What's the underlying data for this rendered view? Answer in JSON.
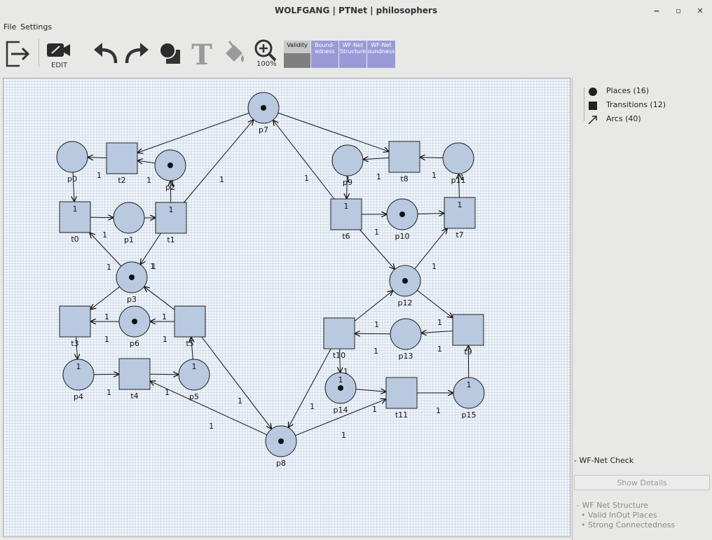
{
  "window": {
    "title": "WOLFGANG | PTNet | philosophers",
    "minimize": "‒",
    "maximize": "▫",
    "close": "✕"
  },
  "menu": {
    "file": "File",
    "settings": "Settings"
  },
  "toolbar": {
    "edit_label": "EDIT",
    "zoom_label": "100%",
    "checks": [
      {
        "label": "Validity",
        "color": "#7f7f7f"
      },
      {
        "label": "Bound-\nedness",
        "color": "#9b9ad8"
      },
      {
        "label": "WF-Net\nStructure",
        "color": "#9b9ad8"
      },
      {
        "label": "WF-Net\noundness",
        "color": "#9b9ad8"
      }
    ]
  },
  "tree": {
    "places": "Places (16)",
    "transitions": "Transitions (12)",
    "arcs": "Arcs (40)"
  },
  "wf_check": {
    "title": "- WF-Net Check",
    "show_details": "Show Details",
    "structure": "- WF Net Structure",
    "items": [
      "• Valid InOut Places",
      "• Strong Connectedness"
    ]
  },
  "net": {
    "fill": "#b8c9e0",
    "places": [
      {
        "id": "p0",
        "tokens": 0
      },
      {
        "id": "p1",
        "tokens": 0
      },
      {
        "id": "p2",
        "tokens": 1
      },
      {
        "id": "p3",
        "tokens": 1
      },
      {
        "id": "p4",
        "tokens": 0
      },
      {
        "id": "p5",
        "tokens": 0
      },
      {
        "id": "p6",
        "tokens": 1
      },
      {
        "id": "p7",
        "tokens": 1
      },
      {
        "id": "p8",
        "tokens": 1
      },
      {
        "id": "p9",
        "tokens": 0
      },
      {
        "id": "p10",
        "tokens": 1
      },
      {
        "id": "p11",
        "tokens": 0
      },
      {
        "id": "p12",
        "tokens": 1
      },
      {
        "id": "p13",
        "tokens": 0
      },
      {
        "id": "p14",
        "tokens": 1
      },
      {
        "id": "p15",
        "tokens": 0
      }
    ],
    "transitions": [
      "t0",
      "t1",
      "t2",
      "t3",
      "t4",
      "t5",
      "t6",
      "t7",
      "t8",
      "t9",
      "t10",
      "t11"
    ],
    "arcs": [
      {
        "from": "t2",
        "to": "p0",
        "label": "1"
      },
      {
        "from": "p2",
        "to": "t2",
        "label": "1"
      },
      {
        "from": "p7",
        "to": "t2",
        "label": "1"
      },
      {
        "from": "p0",
        "to": "t0",
        "label": "1"
      },
      {
        "from": "t0",
        "to": "p1",
        "label": ""
      },
      {
        "from": "p1",
        "to": "t1",
        "label": ""
      },
      {
        "from": "t1",
        "to": "p2",
        "label": "1"
      },
      {
        "from": "t1",
        "to": "p7",
        "label": "1"
      },
      {
        "from": "t1",
        "to": "p3",
        "label": "1"
      },
      {
        "from": "p3",
        "to": "t0",
        "label": "1"
      },
      {
        "from": "p3",
        "to": "t3",
        "label": "1"
      },
      {
        "from": "t5",
        "to": "p3",
        "label": "1"
      },
      {
        "from": "p6",
        "to": "t3",
        "label": "1"
      },
      {
        "from": "t5",
        "to": "p6",
        "label": "1"
      },
      {
        "from": "t3",
        "to": "p4",
        "label": "1"
      },
      {
        "from": "p4",
        "to": "t4",
        "label": "1"
      },
      {
        "from": "t4",
        "to": "p5",
        "label": "1"
      },
      {
        "from": "p5",
        "to": "t5",
        "label": "1"
      },
      {
        "from": "t5",
        "to": "p8",
        "label": "1"
      },
      {
        "from": "p8",
        "to": "t4",
        "label": "1"
      },
      {
        "from": "p7",
        "to": "t8",
        "label": ""
      },
      {
        "from": "t8",
        "to": "p9",
        "label": "1"
      },
      {
        "from": "p11",
        "to": "t8",
        "label": "1"
      },
      {
        "from": "p9",
        "to": "t6",
        "label": "1"
      },
      {
        "from": "t6",
        "to": "p7",
        "label": "1"
      },
      {
        "from": "t6",
        "to": "p10",
        "label": ""
      },
      {
        "from": "p10",
        "to": "t7",
        "label": ""
      },
      {
        "from": "t7",
        "to": "p11",
        "label": "1"
      },
      {
        "from": "t6",
        "to": "p12",
        "label": "1"
      },
      {
        "from": "p12",
        "to": "t7",
        "label": "1"
      },
      {
        "from": "p12",
        "to": "t9",
        "label": ""
      },
      {
        "from": "t10",
        "to": "p12",
        "label": "1"
      },
      {
        "from": "t9",
        "to": "p13",
        "label": "1"
      },
      {
        "from": "p13",
        "to": "t10",
        "label": "1"
      },
      {
        "from": "t10",
        "to": "p14",
        "label": "1"
      },
      {
        "from": "p14",
        "to": "t11",
        "label": "1"
      },
      {
        "from": "t11",
        "to": "p15",
        "label": "1"
      },
      {
        "from": "p15",
        "to": "t9",
        "label": "1"
      },
      {
        "from": "t10",
        "to": "p8",
        "label": "1"
      },
      {
        "from": "p8",
        "to": "t11",
        "label": "1"
      }
    ],
    "inner_weights": [
      {
        "on": "t0",
        "value": "1"
      },
      {
        "on": "t1",
        "value": "1"
      },
      {
        "on": "t6",
        "value": "1"
      },
      {
        "on": "t7",
        "value": "1"
      },
      {
        "on": "p4",
        "value": "1"
      },
      {
        "on": "p5",
        "value": "1"
      },
      {
        "on": "p14",
        "value": "1"
      },
      {
        "on": "p15",
        "value": "1"
      }
    ]
  }
}
